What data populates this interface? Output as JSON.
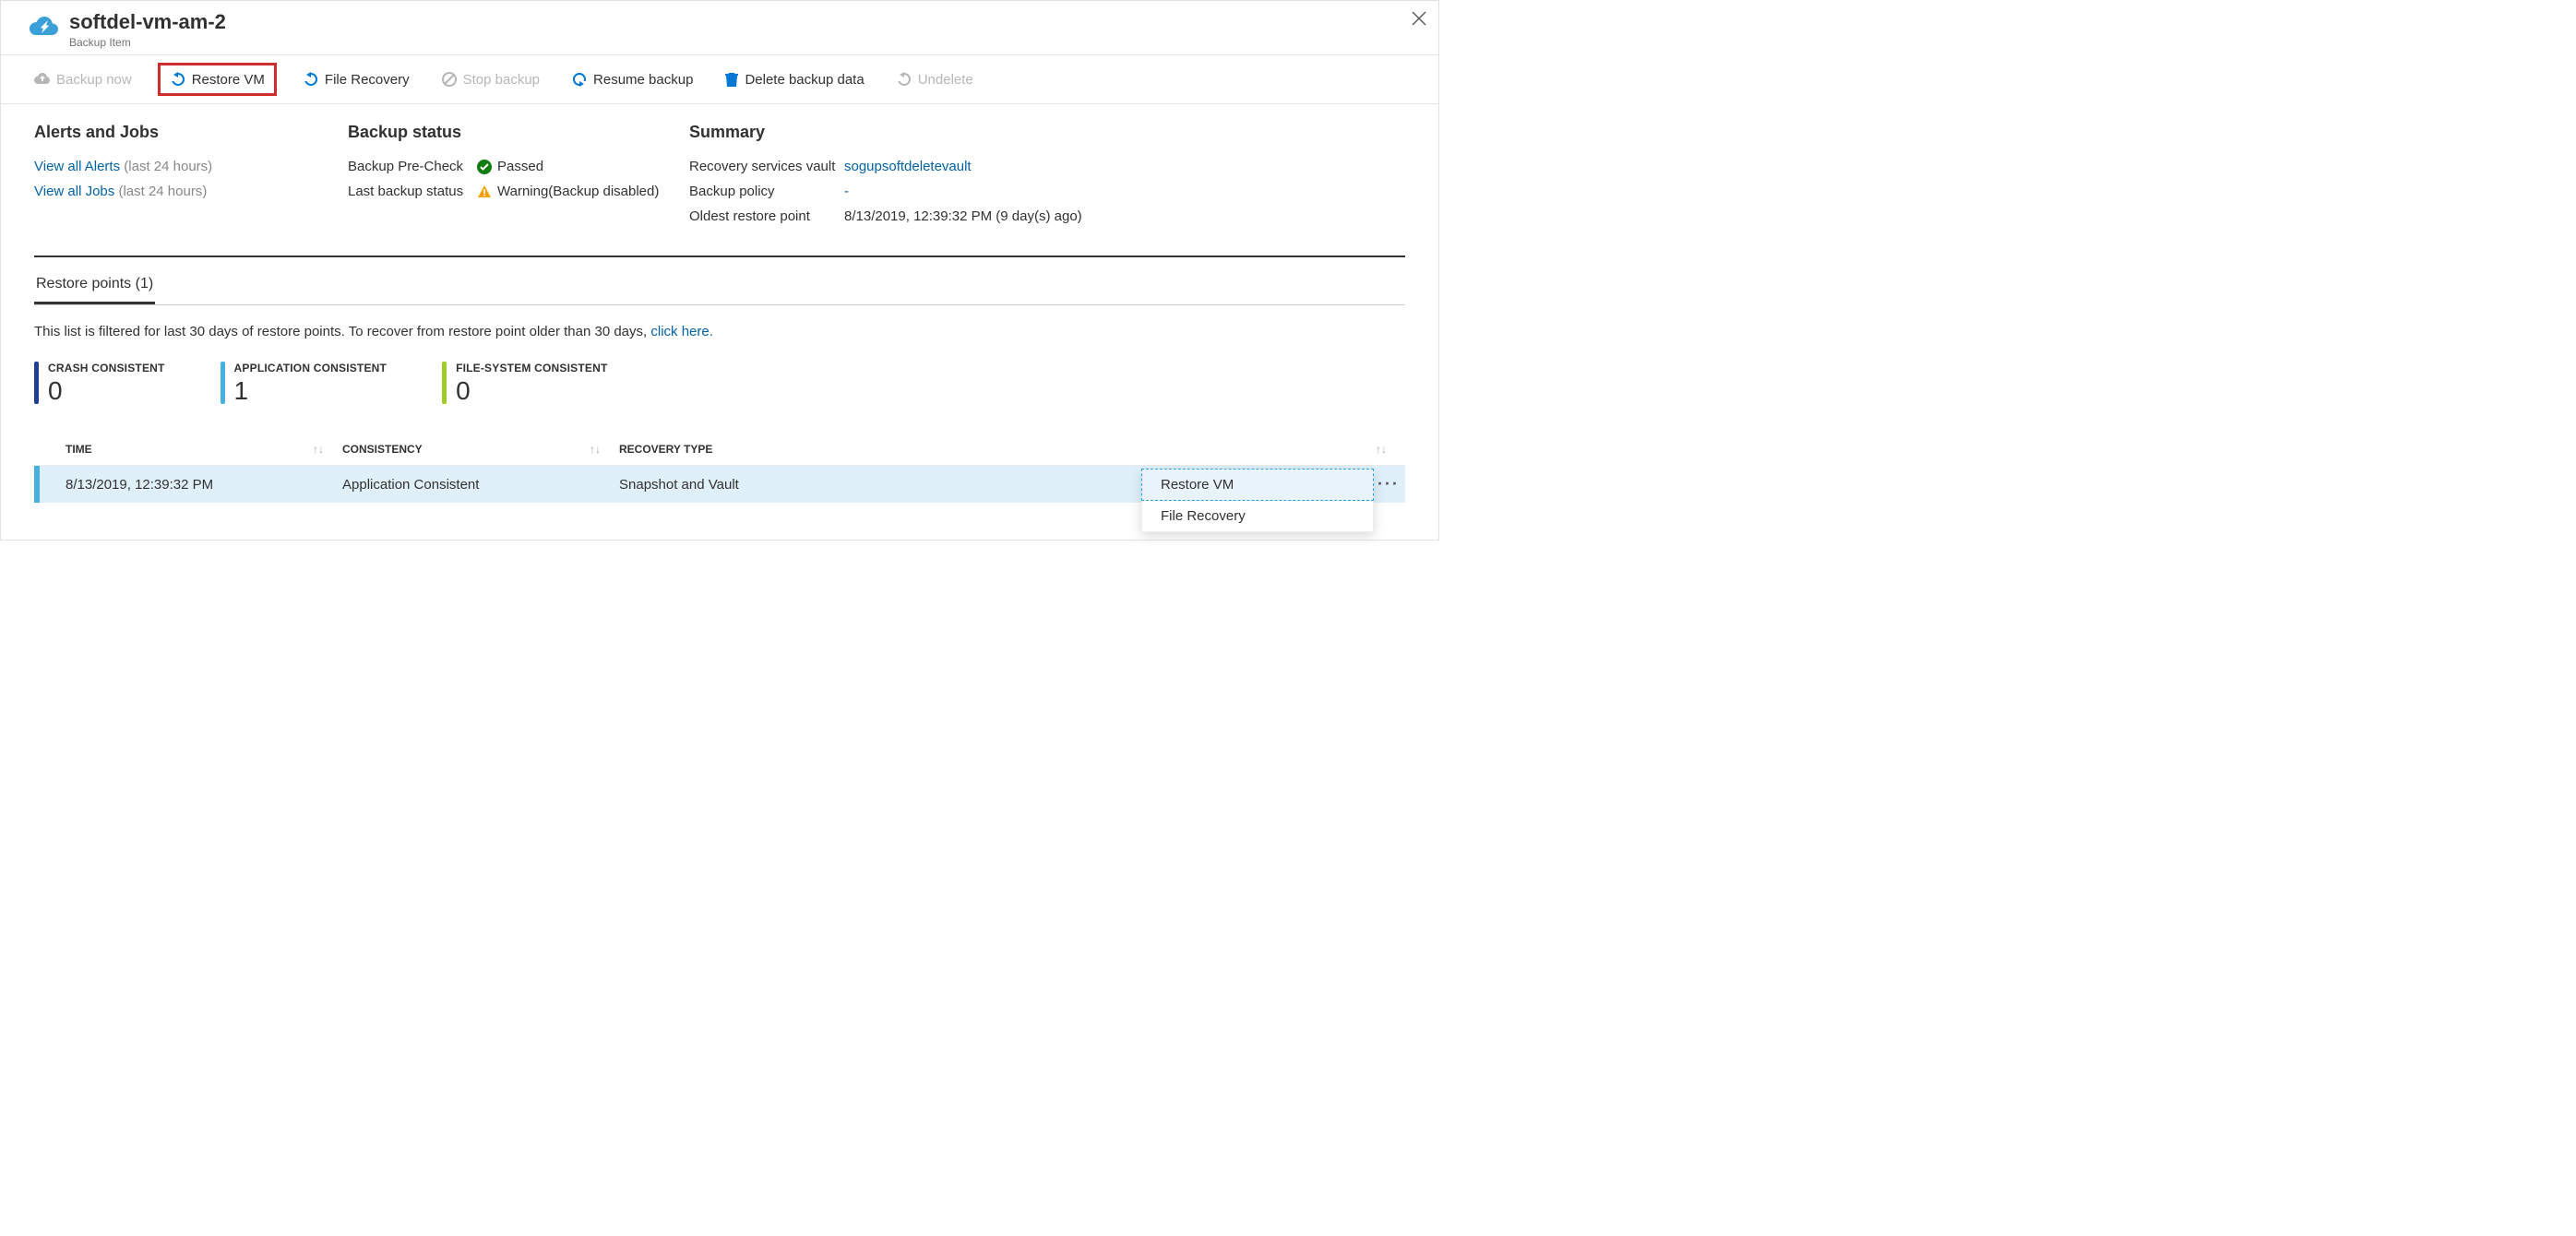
{
  "header": {
    "title": "softdel-vm-am-2",
    "subtitle": "Backup Item"
  },
  "toolbar": {
    "backup_now": "Backup now",
    "restore_vm": "Restore VM",
    "file_recovery": "File Recovery",
    "stop_backup": "Stop backup",
    "resume_backup": "Resume backup",
    "delete_backup_data": "Delete backup data",
    "undelete": "Undelete"
  },
  "alerts": {
    "title": "Alerts and Jobs",
    "view_alerts": "View all Alerts",
    "view_alerts_suffix": "(last 24 hours)",
    "view_jobs": "View all Jobs",
    "view_jobs_suffix": "(last 24 hours)"
  },
  "status": {
    "title": "Backup status",
    "precheck_label": "Backup Pre-Check",
    "precheck_value": "Passed",
    "last_label": "Last backup status",
    "last_value": "Warning(Backup disabled)"
  },
  "summary": {
    "title": "Summary",
    "vault_label": "Recovery services vault",
    "vault_value": "sogupsoftdeletevault",
    "policy_label": "Backup policy",
    "policy_value": "-",
    "oldest_label": "Oldest restore point",
    "oldest_value": "8/13/2019, 12:39:32 PM (9 day(s) ago)"
  },
  "tabs": {
    "restore_points": "Restore points (1)"
  },
  "filter_note_prefix": "This list is filtered for last 30 days of restore points. To recover from restore point older than 30 days, ",
  "filter_note_link": "click here.",
  "counters": {
    "crash_label": "CRASH CONSISTENT",
    "crash_value": "0",
    "app_label": "APPLICATION CONSISTENT",
    "app_value": "1",
    "fs_label": "FILE-SYSTEM CONSISTENT",
    "fs_value": "0"
  },
  "table": {
    "col_time": "TIME",
    "col_consistency": "CONSISTENCY",
    "col_recovery": "RECOVERY TYPE",
    "row": {
      "time": "8/13/2019, 12:39:32 PM",
      "consistency": "Application Consistent",
      "recovery": "Snapshot and Vault"
    }
  },
  "context_menu": {
    "restore_vm": "Restore VM",
    "file_recovery": "File Recovery"
  }
}
